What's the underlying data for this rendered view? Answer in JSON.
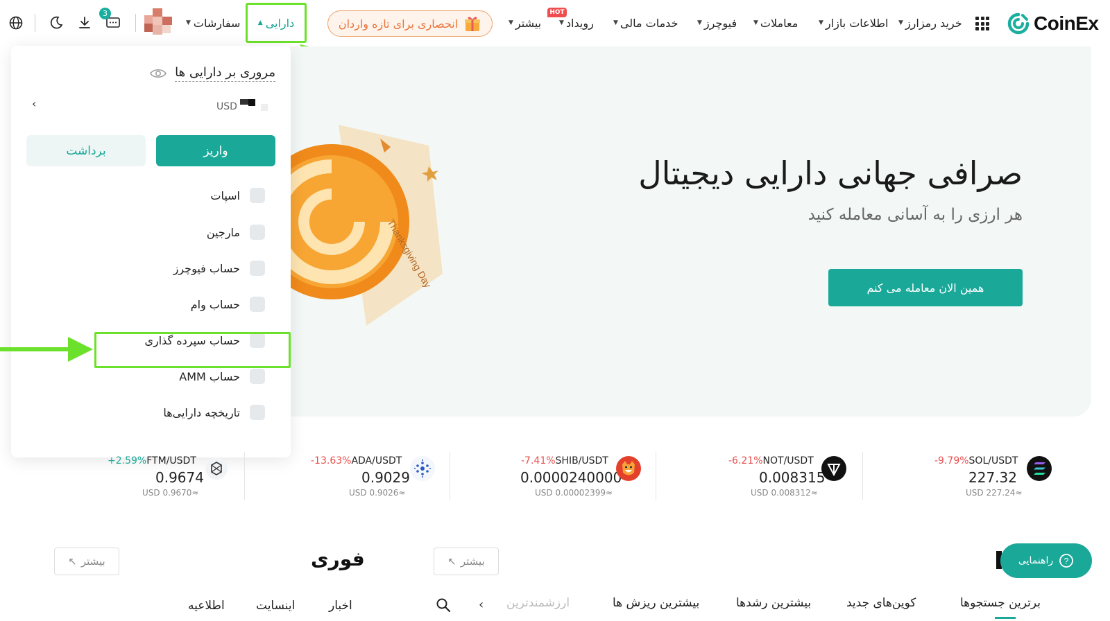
{
  "nav": {
    "logo_text": "CoinEx",
    "items": [
      {
        "label": "خرید رمزارز",
        "caret": true
      },
      {
        "label": "اطلاعات بازار",
        "caret": true
      },
      {
        "label": "معاملات",
        "caret": true
      },
      {
        "label": "فیوچرز",
        "caret": true
      },
      {
        "label": "خدمات مالی",
        "caret": true
      },
      {
        "label": "رویداد",
        "caret": true
      },
      {
        "label": "بیشتر",
        "caret": true
      }
    ],
    "hot_badge": "HOT",
    "promo_label": "انحصاری برای تازه واردان",
    "assets_label": "دارایی",
    "orders_label": "سفارشات",
    "notification_count": "3"
  },
  "hero": {
    "title": "صرافی جهانی دارایی دیجیتال",
    "subtitle": "هر ارزی را به آسانی معامله کنید",
    "cta": "همین الان معامله می کنم",
    "art_text": "Thanksgiving Day"
  },
  "dropdown": {
    "title": "مروری بر دارایی ها",
    "currency": "USD",
    "deposit": "واریز",
    "withdraw": "برداشت",
    "items": [
      {
        "label": "اسپات",
        "icon": "spot-icon"
      },
      {
        "label": "مارجین",
        "icon": "margin-icon"
      },
      {
        "label": "حساب فیوچرز",
        "icon": "futures-account-icon"
      },
      {
        "label": "حساب وام",
        "icon": "loan-account-icon"
      },
      {
        "label": "حساب سپرده گذاری",
        "icon": "deposit-account-icon"
      },
      {
        "label": "حساب AMM",
        "icon": "amm-account-icon"
      },
      {
        "label": "تاریخچه دارایی‌ها",
        "icon": "asset-history-icon"
      }
    ]
  },
  "ticker": [
    {
      "change": "-9.79%",
      "pair": "SOL/USDT",
      "price": "227.32",
      "usd": "USD 227.24≈",
      "color": "#ea4d4d"
    },
    {
      "change": "-6.21%",
      "pair": "NOT/USDT",
      "price": "0.008315",
      "usd": "USD 0.008312≈",
      "color": "#ea4d4d"
    },
    {
      "change": "-7.41%",
      "pair": "SHIB/USDT",
      "price": "0.0000240000",
      "usd": "USD 0.00002399≈",
      "color": "#ea4d4d"
    },
    {
      "change": "-13.63%",
      "pair": "ADA/USDT",
      "price": "0.9029",
      "usd": "USD 0.9026≈",
      "color": "#ea4d4d"
    },
    {
      "change": "+2.59%",
      "pair": "FTM/USDT",
      "price": "0.9674",
      "usd": "USD 0.9670≈",
      "color": "#1aa898"
    }
  ],
  "bottom": {
    "more": "بیشتر",
    "instant": "فوری",
    "guide": "راهنمایی",
    "tabs": [
      "برترین جستجوها",
      "کوین‌های جدید",
      "بیشترین رشدها",
      "بیشترین ریزش ها",
      "ارزشمندترین"
    ],
    "news_tabs": [
      "اخبار",
      "اینسایت",
      "اطلاعیه"
    ]
  },
  "colors": {
    "brand": "#1aa898",
    "highlight": "#6ce12b",
    "negative": "#ea4d4d",
    "promo": "#e9733a"
  }
}
